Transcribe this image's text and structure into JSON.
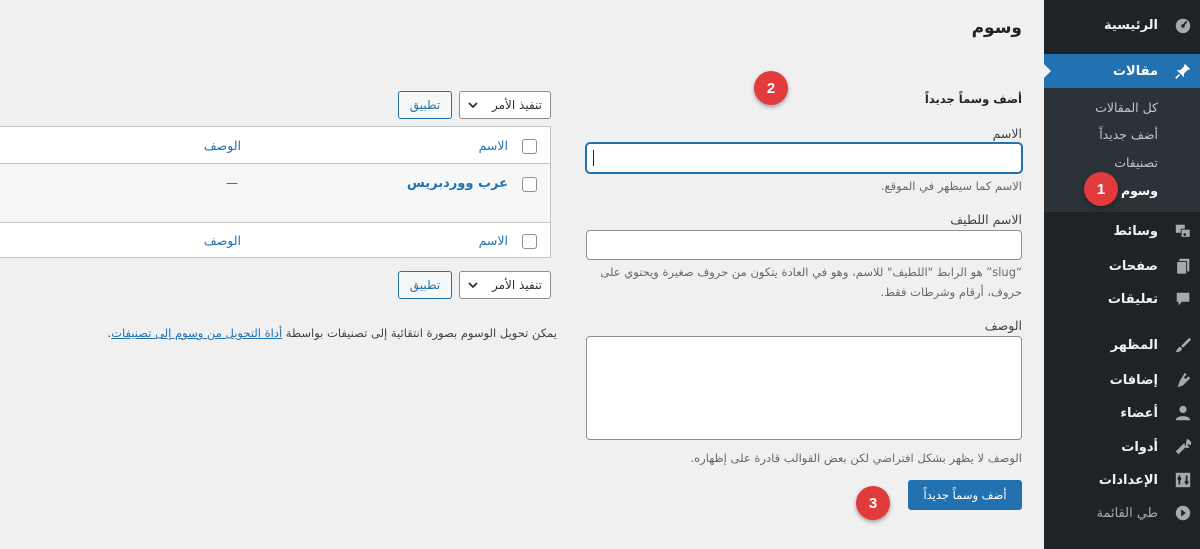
{
  "sidebar": {
    "items": [
      {
        "label": "الرئيسية",
        "icon": "dashboard-icon"
      },
      {
        "label": "مقالات",
        "icon": "pushpin-icon"
      },
      {
        "label": "وسائط",
        "icon": "media-icon"
      },
      {
        "label": "صفحات",
        "icon": "pages-icon"
      },
      {
        "label": "تعليقات",
        "icon": "comment-icon"
      },
      {
        "label": "المظهر",
        "icon": "brush-icon"
      },
      {
        "label": "إضافات",
        "icon": "plugin-icon"
      },
      {
        "label": "أعضاء",
        "icon": "user-icon"
      },
      {
        "label": "أدوات",
        "icon": "wrench-icon"
      },
      {
        "label": "الإعدادات",
        "icon": "settings-icon"
      },
      {
        "label": "طي القائمة",
        "icon": "collapse-icon"
      }
    ],
    "submenu": [
      "كل المقالات",
      "أضف جديداً",
      "تصنيفات",
      "وسوم"
    ]
  },
  "page": {
    "title": "وسوم"
  },
  "form": {
    "heading": "أضف وسماً جديداً",
    "name_label": "الاسم",
    "name_value": "",
    "name_help": "الاسم كما سيظهر في الموقع.",
    "slug_label": "الاسم اللطيف",
    "slug_value": "",
    "slug_help": "“slug” هو الرابط \"اللطيف\" للاسم، وهو في العادة يتكون من حروف صغيرة ويحتوي على حروف، أرقام وشرطات فقط.",
    "desc_label": "الوصف",
    "desc_value": "",
    "desc_help": "الوصف لا يظهر بشكل افتراضي لكن بعض القوالب قادرة على إظهاره.",
    "submit_label": "أضف وسماً جديداً"
  },
  "table": {
    "bulk_action": "تنفيذ الأمر",
    "apply_label": "تطبيق",
    "columns": {
      "name": "الاسم",
      "description": "الوصف"
    },
    "rows": [
      {
        "name": "عرب ووردبريس",
        "description": "—"
      }
    ]
  },
  "convert_note": {
    "text": "يمكن تحويل الوسوم بصورة انتقائية إلى تصنيفات بواسطة",
    "link": "أداة التحويل من وسوم إلى تصنيفات",
    "end": "."
  },
  "annotations": [
    "1",
    "2",
    "3"
  ],
  "colors": {
    "accent": "#2271b1",
    "sidebar": "#1d2327",
    "badge": "#e23b3b",
    "background": "#f0f0f1"
  }
}
